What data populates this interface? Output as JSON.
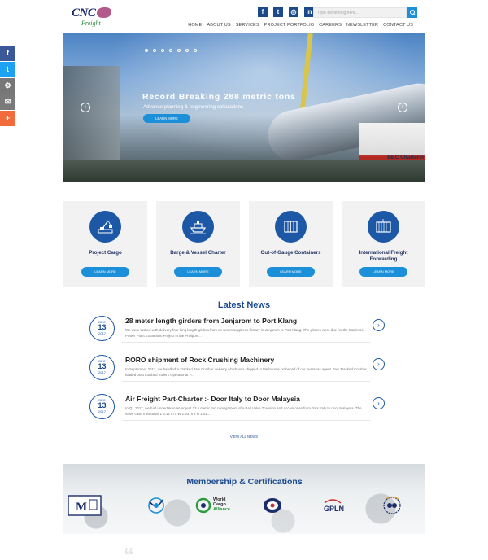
{
  "header": {
    "logo_text": "CNC",
    "logo_sub": "Freight",
    "social": [
      "f",
      "t",
      "◎",
      "in"
    ],
    "search_placeholder": "Type something here..."
  },
  "nav": [
    "HOME",
    "ABOUT US",
    "SERVICES",
    "PROJECT PORTFOLIO",
    "CAREERS",
    "NEWSLETTER",
    "CONTACT US"
  ],
  "share": [
    {
      "glyph": "f",
      "color": "#3b5998"
    },
    {
      "glyph": "t",
      "color": "#1da1f2"
    },
    {
      "glyph": "⚙",
      "color": "#777777"
    },
    {
      "glyph": "✉",
      "color": "#7a7a7a"
    },
    {
      "glyph": "+",
      "color": "#f26b3a"
    }
  ],
  "hero": {
    "title": "Record Breaking 288 metric tons",
    "subtitle": "Advance planning & engineering calculations",
    "button": "LEARN MORE",
    "ship_text": "BBC Charterin",
    "prev": "‹",
    "next": "›"
  },
  "services": [
    {
      "title": "Project Cargo",
      "button": "LEARN MORE",
      "icon": "crane-icon"
    },
    {
      "title": "Barge & Vessel Charter",
      "button": "LEARN MORE",
      "icon": "ship-icon"
    },
    {
      "title": "Out-of-Gauge Containers",
      "button": "LEARN MORE",
      "icon": "container-icon"
    },
    {
      "title": "International Freight Forwarding",
      "button": "LEARN MORE",
      "icon": "freight-container-icon"
    }
  ],
  "news": {
    "heading": "Latest News",
    "items": [
      {
        "month": "DEC",
        "day": "13",
        "year": "2017",
        "title": "28 meter length girders from Jenjarom to Port Klang",
        "body": "We were tasked with delivery four long length girders from ex-works supplier's factory in Jenjarom to Port Klang. The girders were due for the Maximoc Power Plant Expansion Project in the Philippin..."
      },
      {
        "month": "DEC",
        "day": "13",
        "year": "2017",
        "title": "RORO shipment of Rock Crushing Machinery",
        "body": "In September 2017, we handled a Tracked Jaw Crusher delivery which was shipped to Melbourne on behalf of our overseas agent. Jaw Tracked Crusher loaded onto Lowbed trailers Operator at P..."
      },
      {
        "month": "DEC",
        "day": "13",
        "year": "2017",
        "title": "Air Freight Part-Charter :- Door Italy to Door Malaysia",
        "body": "In Q1 2017, we had undertaken an urgent 23.5 metric ton consignment of a Ball Valve Trunnion and accessories from door Italy to door Malaysia. The valve case measured L 5.12 m x W 1.93 m x H 1.41..."
      }
    ],
    "more": "›",
    "view_all": "VIEW ALL NEWS"
  },
  "membership": {
    "title": "Membership & Certifications",
    "logos": {
      "wca_line1": "World",
      "wca_line2": "Cargo",
      "wca_line3": "Alliance",
      "gpln": "GPLN",
      "mff": "M"
    }
  }
}
